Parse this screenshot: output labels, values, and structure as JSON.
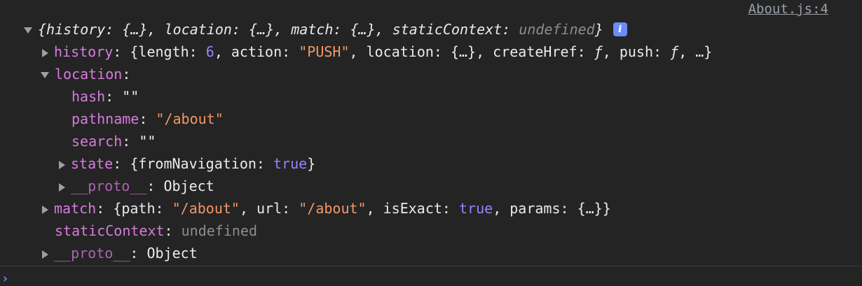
{
  "source": "About.js:4",
  "summary": {
    "text_parts": [
      "{history: {…}, location: {…}, match: {…}, staticContext: ",
      "undefined",
      "}"
    ],
    "info_badge": "i"
  },
  "history": {
    "key": "history",
    "parts": [
      "{length: ",
      "6",
      ", action: ",
      "\"PUSH\"",
      ", location: {…}, createHref: ",
      "ƒ",
      ", push: ",
      "ƒ",
      ", …}"
    ]
  },
  "location": {
    "key": "location",
    "hash": {
      "key": "hash",
      "value": "\"\""
    },
    "pathname": {
      "key": "pathname",
      "value": "\"/about\""
    },
    "search": {
      "key": "search",
      "value": "\"\""
    },
    "state": {
      "key": "state",
      "parts": [
        "{fromNavigation: ",
        "true",
        "}"
      ]
    },
    "proto": {
      "key": "__proto__",
      "value": "Object"
    }
  },
  "match": {
    "key": "match",
    "parts": [
      "{path: ",
      "\"/about\"",
      ", url: ",
      "\"/about\"",
      ", isExact: ",
      "true",
      ", params: {…}}"
    ]
  },
  "staticContext": {
    "key": "staticContext",
    "value": "undefined"
  },
  "proto": {
    "key": "__proto__",
    "value": "Object"
  },
  "colors": {
    "background": "#242424",
    "key": "#d77ae0",
    "string": "#f29766",
    "number": "#9980ff",
    "undefined": "#8d8d8d",
    "prompt": "#6b8cf5"
  },
  "icons": {
    "expanded": "triangle-down-icon",
    "collapsed": "triangle-right-icon",
    "prompt": "chevron-right-icon"
  }
}
